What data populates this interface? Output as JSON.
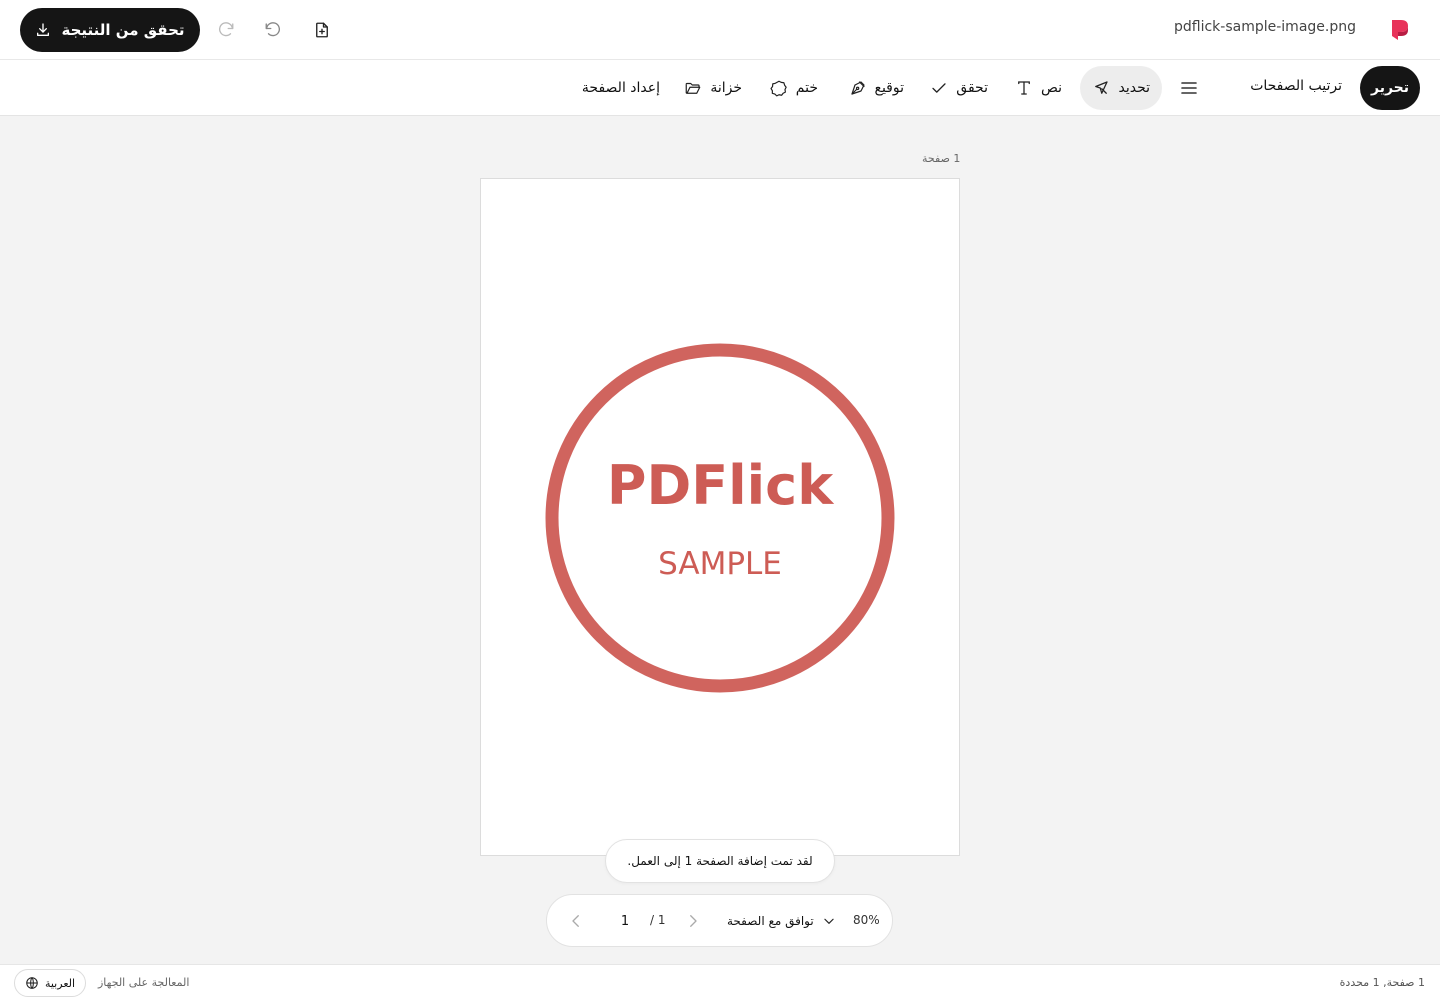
{
  "app": {
    "file_name": "pdflick-sample-image.png",
    "primary_action_label": "تحقق من النتيجة"
  },
  "modes": {
    "edit_label": "تحرير",
    "arrange_label": "ترتيب الصفحات"
  },
  "tools": {
    "select": "تحديد",
    "text": "نص",
    "check": "تحقق",
    "sign": "توقيع",
    "stamp": "ختم",
    "vault": "خزانة",
    "page_setup": "إعداد الصفحة"
  },
  "canvas": {
    "page_count_label": "1 صفحة",
    "stamp_title": "PDFlick",
    "stamp_subtitle": "SAMPLE",
    "stamp_color": "#cd5c55"
  },
  "toast": {
    "message": "لقد تمت إضافة الصفحة 1 إلى العمل."
  },
  "pager": {
    "zoom": "80%",
    "fit_label": "توافق مع الصفحة",
    "total": "/ 1",
    "current": "1"
  },
  "status": {
    "selection": "1 صفحة, 1 محددة",
    "processing": "المعالجة على الجهاز",
    "language": "العربية"
  },
  "colors": {
    "brand": "#e8335a",
    "dark_button": "#151515"
  }
}
